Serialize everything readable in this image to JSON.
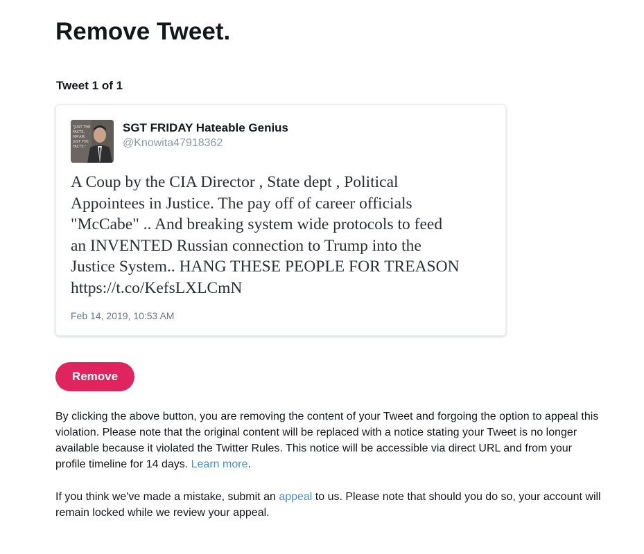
{
  "page": {
    "title": "Remove Tweet.",
    "tweet_counter": "Tweet 1 of 1"
  },
  "tweet": {
    "avatar_icon": "user-avatar-photo",
    "display_name": "SGT FRIDAY Hateable Genius",
    "handle": "@Knowita47918362",
    "text": "A Coup by the CIA Director , State dept , Political\nAppointees in Justice. The pay off of career officials\n\"McCabe\" .. And breaking system wide protocols to feed\nan INVENTED Russian connection to Trump into the\nJustice System.. HANG THESE PEOPLE FOR TREASON\nhttps://t.co/KefsLXLCmN",
    "timestamp": "Feb 14, 2019, 10:53 AM"
  },
  "actions": {
    "remove_label": "Remove"
  },
  "notice": {
    "paragraph1_text": "By clicking the above button, you are removing the content of your Tweet and forgoing the option to appeal this violation. Please note that the original content will be replaced with a notice stating your Tweet is no longer available because it violated the Twitter Rules. This notice will be accessible via direct URL and from your profile timeline for 14 days. ",
    "learn_more_label": "Learn more",
    "paragraph1_end": ".",
    "paragraph2_start": "If you think we've made a mistake, submit an ",
    "appeal_label": "appeal",
    "paragraph2_end": " to us. Please note that should you do so, your account will remain locked while we review your appeal."
  },
  "colors": {
    "remove_button": "#e0245e",
    "link": "#4a90c8",
    "handle": "#8899a6"
  }
}
